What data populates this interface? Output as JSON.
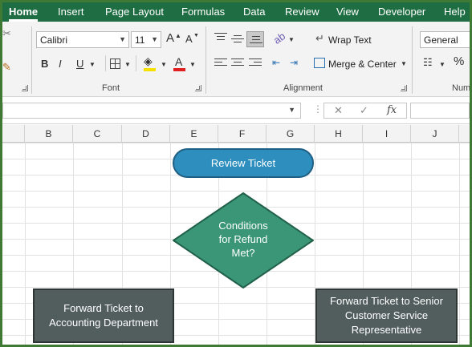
{
  "tabs": [
    "Home",
    "Insert",
    "Page Layout",
    "Formulas",
    "Data",
    "Review",
    "View",
    "Developer",
    "Help"
  ],
  "font": {
    "name": "Calibri",
    "size": "11",
    "grow_label": "A",
    "shrink_label": "A",
    "bold": "B",
    "italic": "I",
    "underline": "U",
    "font_color_label": "A",
    "group_label": "Font"
  },
  "alignment": {
    "wrap_text": "Wrap Text",
    "merge_center": "Merge & Center",
    "group_label": "Alignment"
  },
  "number": {
    "format": "General",
    "group_label": "Numb"
  },
  "formula_bar": {
    "cancel": "✕",
    "enter": "✓",
    "fx": "fx"
  },
  "columns": [
    "B",
    "C",
    "D",
    "E",
    "F",
    "G",
    "H",
    "I",
    "J"
  ],
  "flowchart": {
    "start": "Review Ticket",
    "decision": [
      "Conditions",
      "for Refund",
      "Met?"
    ],
    "left_process": [
      "Forward Ticket  to",
      "Accounting Department"
    ],
    "right_process": [
      "Forward Ticket to Senior",
      "Customer Service",
      "Representative"
    ]
  },
  "colors": {
    "ribbon_tab": "#1f6e43",
    "terminator": "#2e8fbf",
    "decision": "#3a9677",
    "process": "#525e5e"
  }
}
